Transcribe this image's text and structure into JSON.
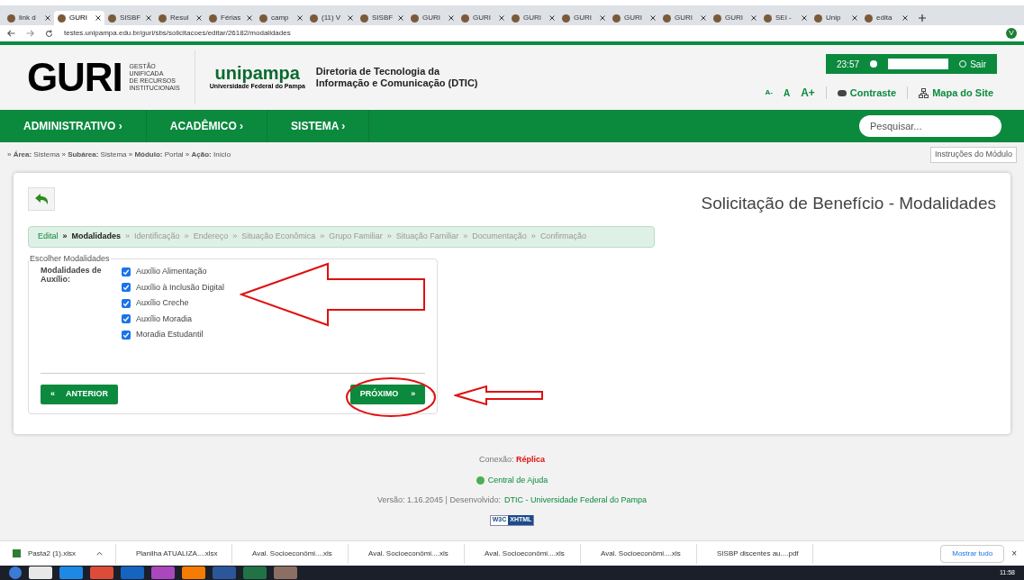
{
  "browser": {
    "tabs": [
      {
        "label": "link d",
        "selected": false
      },
      {
        "label": "GURI",
        "selected": true
      },
      {
        "label": "SISBF",
        "selected": false
      },
      {
        "label": "Resul",
        "selected": false
      },
      {
        "label": "Férias",
        "selected": false
      },
      {
        "label": "camp",
        "selected": false
      },
      {
        "label": "(11) V",
        "selected": false
      },
      {
        "label": "SISBF",
        "selected": false
      },
      {
        "label": "GURI",
        "selected": false
      },
      {
        "label": "GURI",
        "selected": false
      },
      {
        "label": "GURI",
        "selected": false
      },
      {
        "label": "GURI",
        "selected": false
      },
      {
        "label": "GURI",
        "selected": false
      },
      {
        "label": "GURI",
        "selected": false
      },
      {
        "label": "GURI",
        "selected": false
      },
      {
        "label": "SEI -",
        "selected": false
      },
      {
        "label": "Unip",
        "selected": false
      },
      {
        "label": "edita",
        "selected": false
      }
    ],
    "address": "testes.unipampa.edu.br/guri/sbs/solicitacoes/editar/26182/modalidades",
    "profile": "V"
  },
  "header": {
    "logo": "GURI",
    "logo_subtitle": [
      "GESTÃO",
      "UNIFICADA",
      "DE RECURSOS",
      "INSTITUCIONAIS"
    ],
    "uni_logo": "unipampa",
    "uni_subtitle": "Universidade Federal do Pampa",
    "department": [
      "Diretoria de Tecnologia da",
      "Informação e Comunicação (DTIC)"
    ],
    "time": "23:57",
    "logout": "Sair",
    "font_sizes": [
      "A-",
      "A",
      "A+"
    ],
    "contrast": "Contraste",
    "sitemap": "Mapa do Site"
  },
  "nav": {
    "items": [
      "ADMINISTRATIVO ›",
      "ACADÊMICO ›",
      "SISTEMA ›"
    ],
    "search_placeholder": "Pesquisar..."
  },
  "breadcrumb": "» **Área:** Sistema » **Subárea:** Sistema » **Módulo:** Portal » **Ação:** Início",
  "module_help": "Instruções do Módulo",
  "page_title": "Solicitação de Benefício - Modalidades",
  "steps": {
    "separator": "»",
    "items": [
      {
        "label": "Edital",
        "completed": true,
        "selected": false
      },
      {
        "label": "Modalidades",
        "completed": false,
        "selected": true
      },
      {
        "label": "Identificação",
        "completed": false,
        "selected": false
      },
      {
        "label": "Endereço",
        "completed": false,
        "selected": false
      },
      {
        "label": "Situação Econômica",
        "completed": false,
        "selected": false
      },
      {
        "label": "Grupo Familiar",
        "completed": false,
        "selected": false
      },
      {
        "label": "Situação Familiar",
        "completed": false,
        "selected": false
      },
      {
        "label": "Documentação",
        "completed": false,
        "selected": false
      },
      {
        "label": "Confirmação",
        "completed": false,
        "selected": false
      }
    ]
  },
  "form": {
    "legend": "Escolher Modalidades",
    "label": "Modalidades de Auxílio:",
    "options": [
      {
        "label": "Auxílio Alimentação",
        "checked": true
      },
      {
        "label": "Auxílio à Inclusão Digital",
        "checked": true
      },
      {
        "label": "Auxílio Creche",
        "checked": true
      },
      {
        "label": "Auxílio Moradia",
        "checked": true
      },
      {
        "label": "Moradia Estudantil",
        "checked": true
      }
    ],
    "back": {
      "icon": "«",
      "label": "ANTERIOR"
    },
    "next": {
      "label": "PRÓXIMO",
      "icon": "»"
    }
  },
  "footer": {
    "connection_label": "Conexão:",
    "connection": "Réplica",
    "help": "Central de Ajuda",
    "version": "Versão: 1.16.2045 | Desenvolvido:",
    "developer": "DTIC - Universidade Federal do Pampa",
    "badge": [
      "W3C",
      "XHTML"
    ]
  },
  "downloads": {
    "items": [
      {
        "name": "Pasta2 (1).xlsx",
        "kind": "sheet"
      },
      {
        "name": "Planilha ATUALIZA....xlsx",
        "kind": "sheet"
      },
      {
        "name": "Aval. Socioeconômi....xls",
        "kind": "sheet"
      },
      {
        "name": "Aval. Socioeconômi....xls",
        "kind": "sheet"
      },
      {
        "name": "Aval. Socioeconômi....xls",
        "kind": "sheet"
      },
      {
        "name": "Aval. Socioeconômi....xls",
        "kind": "sheet"
      },
      {
        "name": "SISBP discentes au....pdf",
        "kind": "pdf"
      }
    ],
    "show_all": "Mostrar tudo",
    "close": "×"
  },
  "taskbar": {
    "clock": "11:58"
  }
}
